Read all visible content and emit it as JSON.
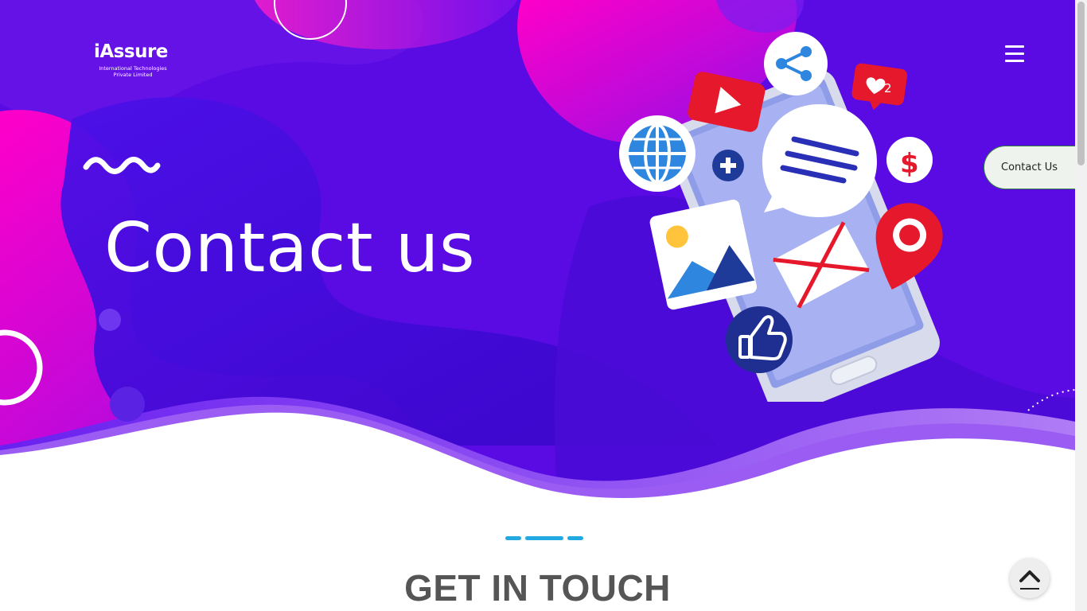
{
  "header": {
    "logo_word": "iAssure",
    "logo_subtitle": "International Technologies Private Limited",
    "menu_icon": "hamburger-menu-icon"
  },
  "hero": {
    "title": "Contact us",
    "illustration_icons": [
      "share-icon",
      "youtube-play-icon",
      "heart-notification-icon",
      "globe-icon",
      "plus-icon",
      "chat-bubble-icon",
      "dollar-icon",
      "image-icon",
      "mail-icon",
      "location-pin-icon",
      "thumbs-up-icon"
    ],
    "like_count": "2"
  },
  "side_tab": {
    "label": "Contact Us"
  },
  "section": {
    "title": "GET IN TOUCH"
  },
  "scroll_top": {
    "icon": "chevron-up-icon"
  },
  "colors": {
    "hero_purple": "#5a0be3",
    "hero_magenta": "#ff00cc",
    "accent_blue": "#23a9e1",
    "heading_gray": "#555555"
  }
}
